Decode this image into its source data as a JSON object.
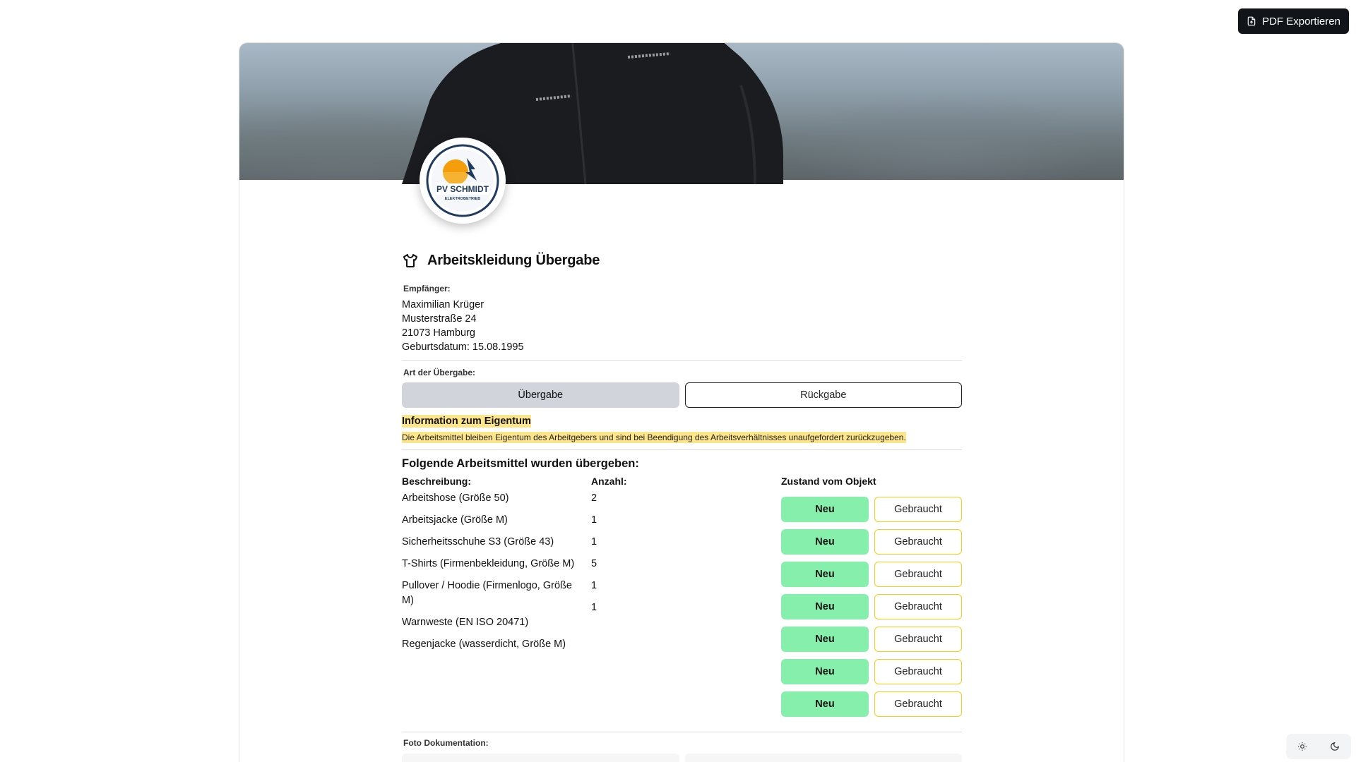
{
  "toolbar": {
    "export_label": "PDF Exportieren"
  },
  "header": {
    "title": "Arbeitskleidung Übergabe"
  },
  "logo": {
    "line1": "PV SCHMIDT",
    "line2": "ELEKTROBETRIEB"
  },
  "recipient": {
    "label": "Empfänger:",
    "name": "Maximilian Krüger",
    "street": "Musterstraße 24",
    "city": "21073 Hamburg",
    "birthdate": "Geburtsdatum: 15.08.1995"
  },
  "transfer_type": {
    "label": "Art der Übergabe:",
    "options": [
      "Übergabe",
      "Rückgabe"
    ],
    "selected": "Übergabe"
  },
  "info": {
    "title": "Information zum Eigentum",
    "text": "Die Arbeitsmittel bleiben Eigentum des Arbeitgebers und sind bei Beendigung des Arbeitsverhältnisses unaufgefordert zurückzugeben."
  },
  "items": {
    "title": "Folgende Arbeitsmittel wurden übergeben:",
    "headers": {
      "description": "Beschreibung:",
      "quantity": "Anzahl:",
      "condition": "Zustand vom Objekt"
    },
    "descriptions": [
      "Arbeitshose (Größe 50)",
      "Arbeitsjacke (Größe M)",
      "Sicherheitsschuhe S3 (Größe 43)",
      "T-Shirts (Firmenbekleidung, Größe M)",
      "Pullover / Hoodie (Firmenlogo, Größe M)",
      "Warnweste (EN ISO 20471)",
      "Regenjacke (wasserdicht, Größe M)"
    ],
    "quantities": [
      "2",
      "1",
      "1",
      "5",
      "1",
      "1"
    ],
    "condition_new": "Neu",
    "condition_used": "Gebraucht"
  },
  "photo": {
    "label": "Foto Dokumentation:"
  },
  "colors": {
    "accent_new": "#86efac",
    "accent_used": "#facc15",
    "highlight": "#fde68a"
  },
  "icons": [
    "file-export-icon",
    "shirt-icon",
    "sun-icon",
    "moon-icon"
  ]
}
